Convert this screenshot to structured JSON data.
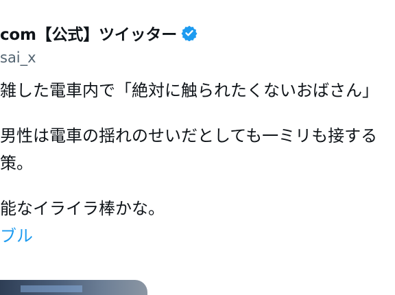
{
  "tweet": {
    "display_name": "com【公式】ツイッター",
    "verified_icon": "verified-badge-icon",
    "handle": "sai_x",
    "lines": [
      "雑した電車内で「絶対に触られたくないおばさん」",
      "",
      "男性は電車の揺れのせいだとしても一ミリも接する",
      "策。",
      "",
      "能なイライラ棒かな。"
    ],
    "hashtag": "ブル",
    "media_icon": "photo-icon"
  },
  "colors": {
    "text": "#0f1419",
    "secondary": "#536471",
    "accent": "#1d9bf0"
  }
}
